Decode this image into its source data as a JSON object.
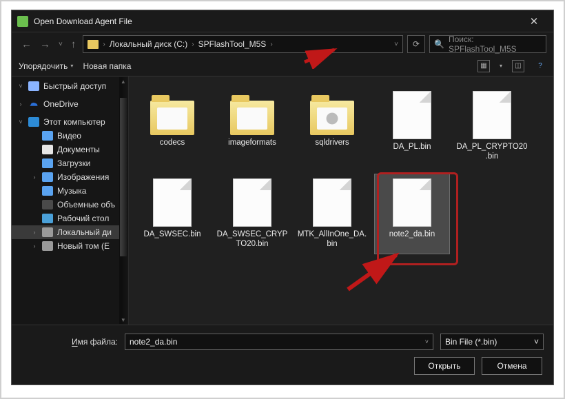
{
  "window": {
    "title": "Open Download Agent File",
    "close_glyph": "✕"
  },
  "nav": {
    "back": "←",
    "fwd": "→",
    "up": "↑",
    "dd": "˅",
    "refresh": "⟳"
  },
  "breadcrumb": {
    "root": "",
    "items": [
      "Локальный диск (C:)",
      "SPFlashTool_M5S"
    ],
    "sep": "›"
  },
  "search": {
    "placeholder": "Поиск: SPFlashTool_M5S",
    "icon": "🔍"
  },
  "toolbar": {
    "organize": "Упорядочить",
    "newfolder": "Новая папка",
    "caret": "▾",
    "help": "?"
  },
  "sidebar": {
    "items": [
      {
        "label": "Быстрый доступ",
        "icon": "i-star",
        "chev": "˅",
        "sub": false
      },
      {
        "label": "OneDrive",
        "icon": "i-cloud",
        "chev": "›",
        "sub": false
      },
      {
        "label": "Этот компьютер",
        "icon": "i-pc",
        "chev": "˅",
        "sub": false
      },
      {
        "label": "Видео",
        "icon": "i-vid",
        "chev": "",
        "sub": true
      },
      {
        "label": "Документы",
        "icon": "i-doc",
        "chev": "",
        "sub": true
      },
      {
        "label": "Загрузки",
        "icon": "i-dl",
        "chev": "",
        "sub": true
      },
      {
        "label": "Изображения",
        "icon": "i-img",
        "chev": "›",
        "sub": true
      },
      {
        "label": "Музыка",
        "icon": "i-mus",
        "chev": "",
        "sub": true
      },
      {
        "label": "Объемные объ",
        "icon": "i-3d",
        "chev": "",
        "sub": true
      },
      {
        "label": "Рабочий стол",
        "icon": "i-desk",
        "chev": "",
        "sub": true
      },
      {
        "label": "Локальный ди",
        "icon": "i-disk",
        "chev": "›",
        "sub": true,
        "sel": true
      },
      {
        "label": "Новый том (E",
        "icon": "i-disk",
        "chev": "›",
        "sub": true
      }
    ]
  },
  "files": {
    "items": [
      {
        "name": "codecs",
        "type": "folder"
      },
      {
        "name": "imageformats",
        "type": "folder"
      },
      {
        "name": "sqldrivers",
        "type": "folder-gear"
      },
      {
        "name": "DA_PL.bin",
        "type": "file"
      },
      {
        "name": "DA_PL_CRYPTO20.bin",
        "type": "file"
      },
      {
        "name": "DA_SWSEC.bin",
        "type": "file"
      },
      {
        "name": "DA_SWSEC_CRYPTO20.bin",
        "type": "file"
      },
      {
        "name": "MTK_AllInOne_DA.bin",
        "type": "file"
      },
      {
        "name": "note2_da.bin",
        "type": "file",
        "sel": true
      }
    ]
  },
  "bottom": {
    "filename_label": "Имя файла:",
    "filename_hot": "И",
    "filename_rest": "мя файла:",
    "filename_value": "note2_da.bin",
    "filter": "Bin File (*.bin)",
    "open_hot": "О",
    "open_rest": "ткрыть",
    "cancel": "Отмена",
    "dd": "˅"
  }
}
